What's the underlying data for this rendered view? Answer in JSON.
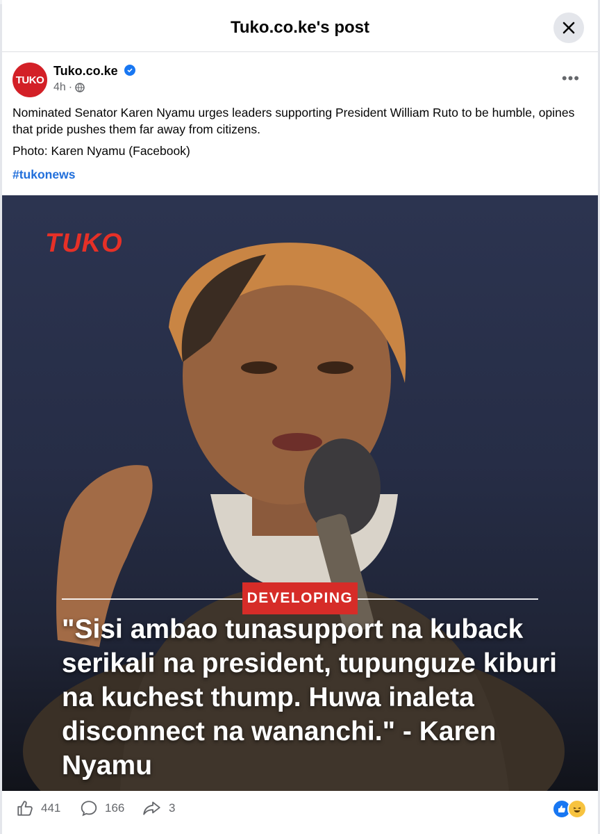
{
  "header": {
    "title": "Tuko.co.ke's post"
  },
  "post": {
    "avatar_text": "TUKO",
    "page_name": "Tuko.co.ke",
    "time": "4h",
    "caption": "Nominated Senator Karen Nyamu urges leaders supporting President William Ruto to be humble, opines that pride pushes them far away from citizens.",
    "photo_credit": "Photo: Karen Nyamu (Facebook)",
    "hashtag": "#tukonews"
  },
  "image": {
    "logo": "TUKO",
    "badge": "DEVELOPING",
    "quote": "\"Sisi ambao tunasupport na kuback serikali na president, tupunguze kiburi na kuchest thump. Huwa inaleta disconnect na wananchi.\" - Karen Nyamu"
  },
  "actions": {
    "likes": "441",
    "comments": "166",
    "shares": "3"
  },
  "colors": {
    "brand_red": "#d32027",
    "link_blue": "#216fdb",
    "fb_blue": "#1877f2"
  }
}
